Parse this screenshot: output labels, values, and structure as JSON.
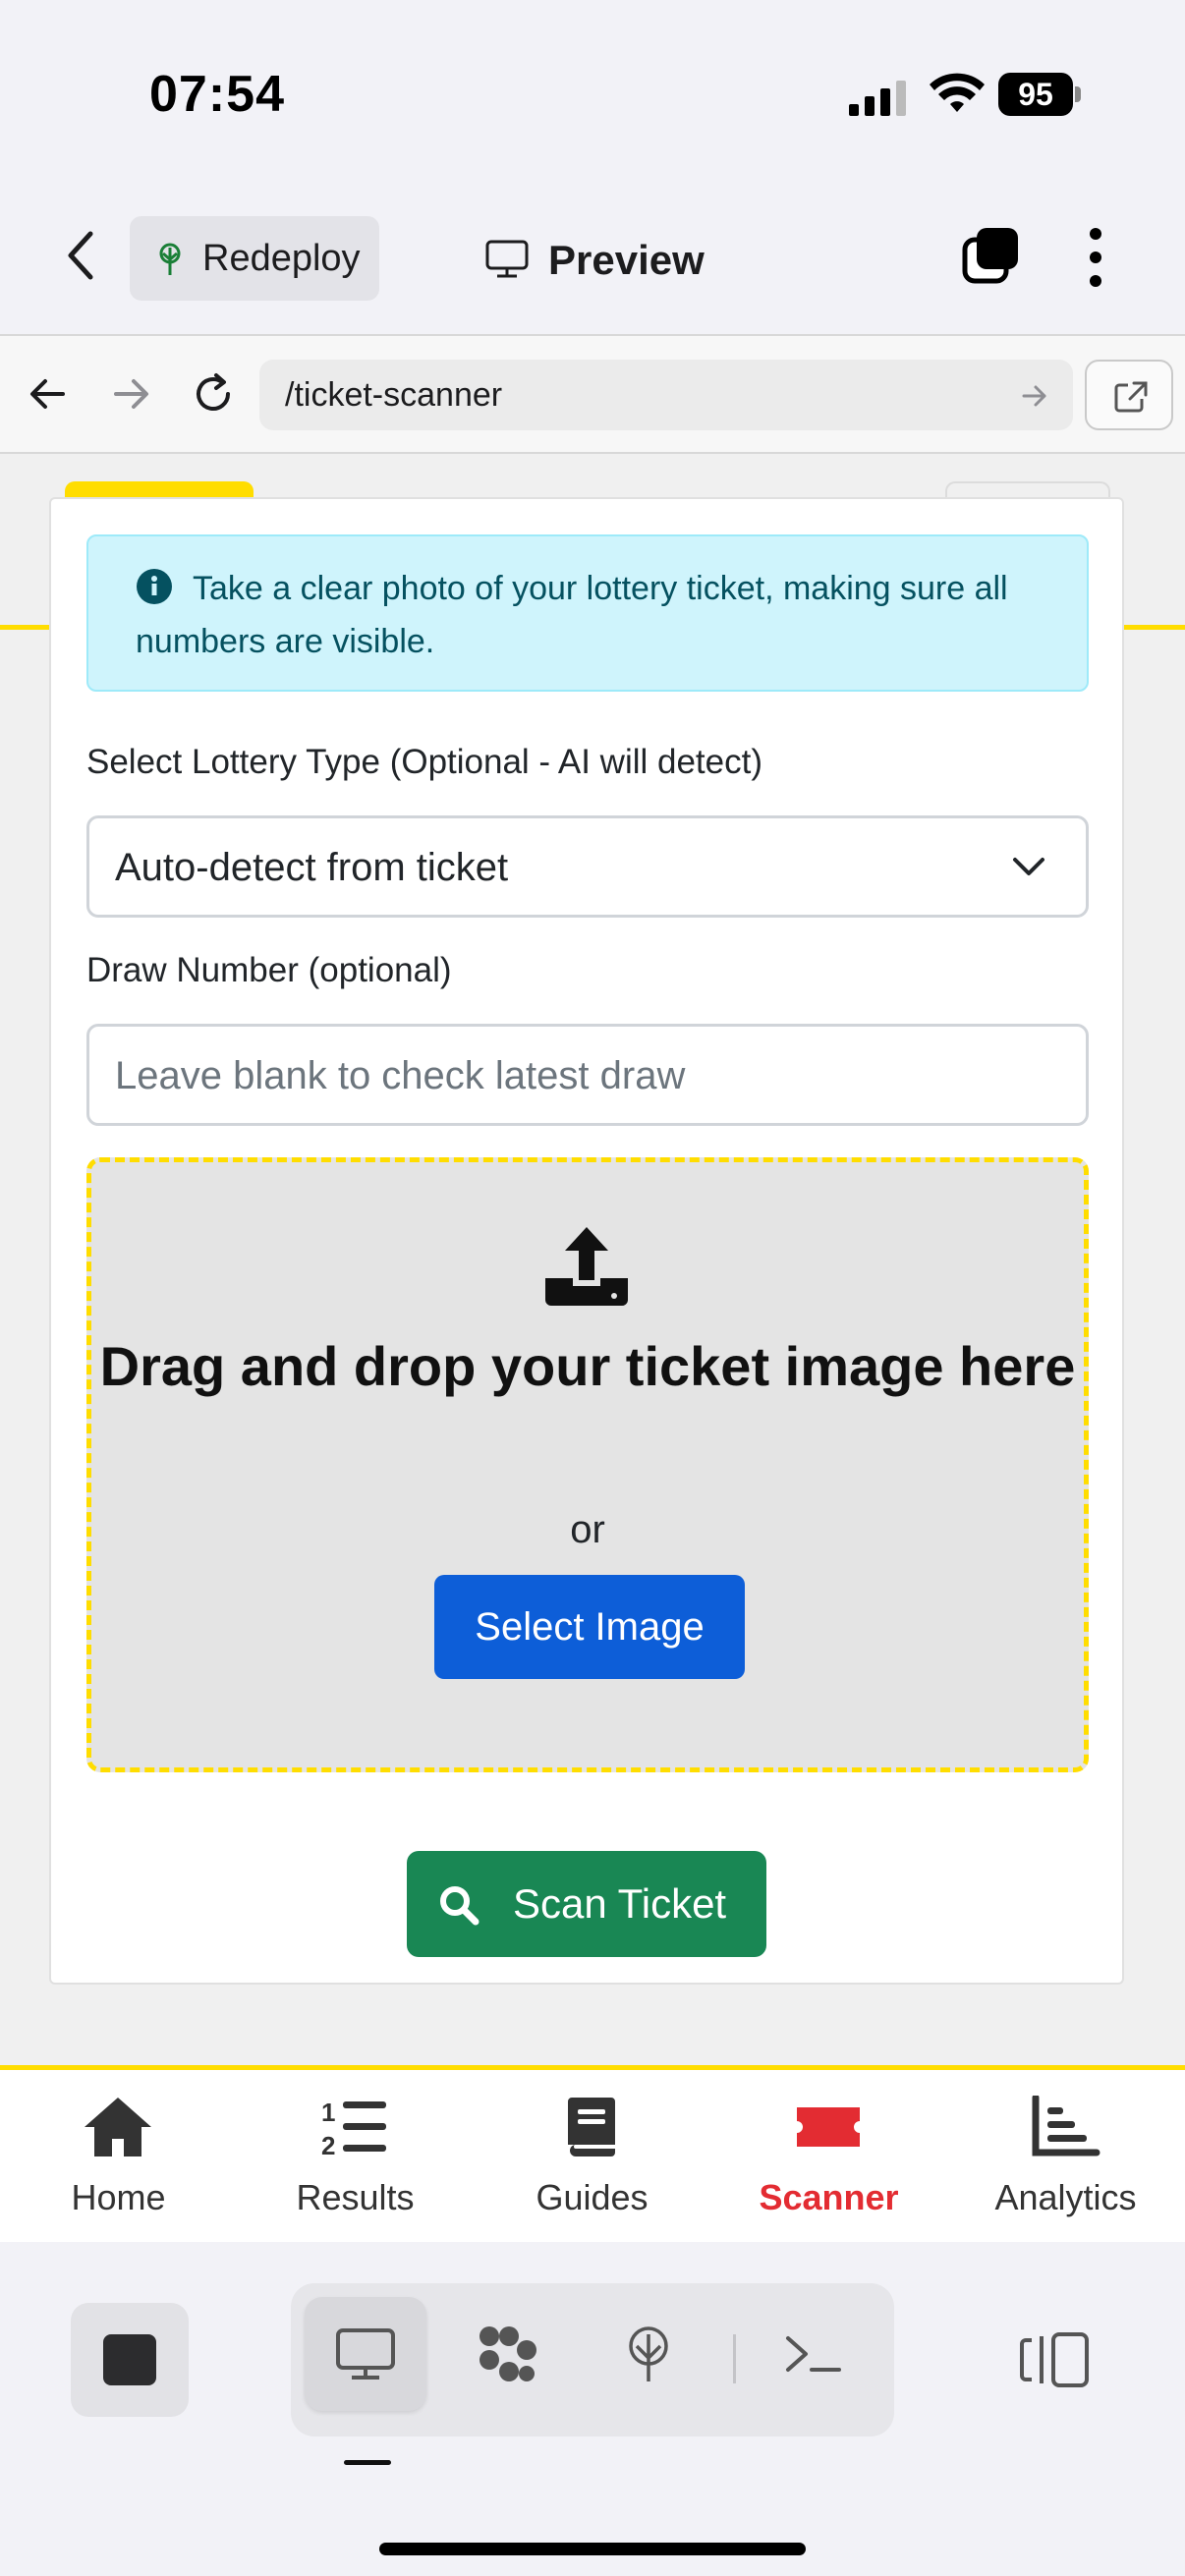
{
  "status_bar": {
    "time": "07:54",
    "battery": "95"
  },
  "app_header": {
    "redeploy_label": "Redeploy",
    "preview_label": "Preview"
  },
  "url_bar": {
    "url": "/ticket-scanner"
  },
  "alert": {
    "text": "Take a clear photo of your lottery ticket, making sure all numbers are visible."
  },
  "form": {
    "lottery_type_label": "Select Lottery Type (Optional - AI will detect)",
    "lottery_type_value": "Auto-detect from ticket",
    "draw_number_label": "Draw Number (optional)",
    "draw_number_placeholder": "Leave blank to check latest draw",
    "draw_number_value": ""
  },
  "dropzone": {
    "heading": "Drag and drop your ticket image here",
    "or_text": "or",
    "select_button": "Select Image"
  },
  "scan_button": "Scan Ticket",
  "bottom_nav": {
    "items": [
      {
        "label": "Home",
        "icon": "home-icon",
        "active": false
      },
      {
        "label": "Results",
        "icon": "list-ol-icon",
        "active": false
      },
      {
        "label": "Guides",
        "icon": "book-icon",
        "active": false
      },
      {
        "label": "Scanner",
        "icon": "ticket-icon",
        "active": true
      },
      {
        "label": "Analytics",
        "icon": "bar-chart-icon",
        "active": false
      }
    ]
  },
  "colors": {
    "accent_yellow": "#ffdd00",
    "primary_blue": "#0d5ed8",
    "success_green": "#198754",
    "active_red": "#e32c32",
    "alert_bg": "#cff4fc"
  }
}
